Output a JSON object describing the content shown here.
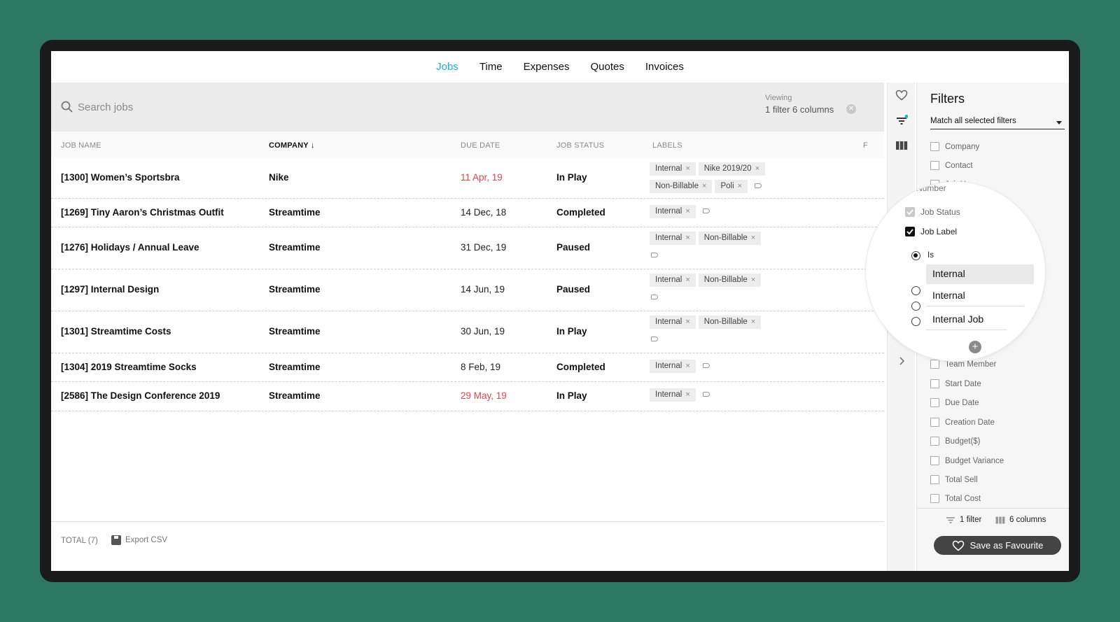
{
  "nav": {
    "items": [
      {
        "label": "Jobs",
        "active": true
      },
      {
        "label": "Time"
      },
      {
        "label": "Expenses"
      },
      {
        "label": "Quotes"
      },
      {
        "label": "Invoices"
      }
    ]
  },
  "search": {
    "placeholder": "Search jobs",
    "value": ""
  },
  "viewing": {
    "label": "Viewing",
    "value": "1 filter 6 columns"
  },
  "table": {
    "columns": {
      "job_name": "JOB NAME",
      "company": "COMPANY ↓",
      "due_date": "DUE DATE",
      "job_status": "JOB STATUS",
      "labels": "LABELS",
      "cut": "F"
    },
    "rows": [
      {
        "name": "[1300] Women’s Sportsbra",
        "company": "Nike",
        "due": "11 Apr, 19",
        "overdue": true,
        "status": "In Play",
        "labels": [
          "Internal",
          "Nike 2019/20",
          "Non-Billable",
          "Poli"
        ]
      },
      {
        "name": "[1269] Tiny Aaron’s Christmas Outfit",
        "company": "Streamtime",
        "due": "14 Dec, 18",
        "overdue": false,
        "status": "Completed",
        "labels": [
          "Internal"
        ]
      },
      {
        "name": "[1276] Holidays / Annual Leave",
        "company": "Streamtime",
        "due": "31 Dec, 19",
        "overdue": false,
        "status": "Paused",
        "labels": [
          "Internal",
          "Non-Billable"
        ]
      },
      {
        "name": "[1297] Internal Design",
        "company": "Streamtime",
        "due": "14 Jun, 19",
        "overdue": false,
        "status": "Paused",
        "labels": [
          "Internal",
          "Non-Billable"
        ]
      },
      {
        "name": "[1301] Streamtime Costs",
        "company": "Streamtime",
        "due": "30 Jun, 19",
        "overdue": false,
        "status": "In Play",
        "labels": [
          "Internal",
          "Non-Billable"
        ]
      },
      {
        "name": "[1304] 2019 Streamtime Socks",
        "company": "Streamtime",
        "due": "8 Feb, 19",
        "overdue": false,
        "status": "Completed",
        "labels": [
          "Internal"
        ]
      },
      {
        "name": "[2586] The Design Conference 2019",
        "company": "Streamtime",
        "due": "29 May, 19",
        "overdue": true,
        "status": "In Play",
        "labels": [
          "Internal"
        ]
      }
    ]
  },
  "footer": {
    "total": "TOTAL (7)",
    "export": "Export CSV"
  },
  "filters": {
    "title": "Filters",
    "match": "Match all selected filters",
    "options_top": [
      "Company",
      "Contact"
    ],
    "partial_top": "Job N",
    "partial_number": "Number",
    "options_bottom": [
      "Team Member",
      "Start Date",
      "Due Date",
      "Creation Date",
      "Budget($)",
      "Budget Variance",
      "Total Sell",
      "Total Cost"
    ],
    "stats": {
      "filters": "1 filter",
      "columns": "6 columns"
    },
    "favourite": "Save as Favourite"
  },
  "magnifier": {
    "job_status": "Job Status",
    "job_label": "Job Label",
    "is": "Is",
    "input_value": "Internal",
    "suggestions": [
      "Internal",
      "Internal Job"
    ]
  },
  "colors": {
    "accent": "#1db4c3",
    "overdue": "#e0454f",
    "background": "#2e7763"
  }
}
